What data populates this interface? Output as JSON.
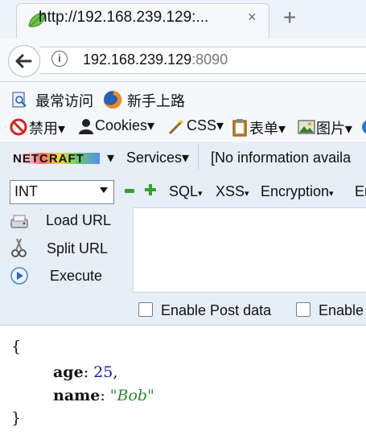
{
  "tab": {
    "title": "http://192.168.239.129:...",
    "close": "×",
    "new_tab": "+"
  },
  "nav": {
    "url_host": "192.168.239.129",
    "url_port": ":8090"
  },
  "bookmarks": [
    {
      "label": "最常访问",
      "icon": "bookmark-page-icon"
    },
    {
      "label": "新手上路",
      "icon": "firefox-icon"
    }
  ],
  "devbar": {
    "disable": "禁用",
    "cookies": "Cookies",
    "css": "CSS",
    "forms": "表单",
    "images": "图片"
  },
  "netcraft": {
    "logo": "NETCRAFT",
    "services": "Services",
    "info": "[No information availa"
  },
  "hackbar": {
    "select_value": "INT",
    "menus": {
      "sql": "SQL",
      "xss": "XSS",
      "encryption": "Encryption",
      "cut": "En"
    },
    "load_url": "Load URL",
    "split_url": "Split URL",
    "execute": "Execute",
    "post_data": "Enable Post data",
    "referrer": "Enable"
  },
  "content": {
    "open_brace": "{",
    "close_brace": "}",
    "fields": [
      {
        "key": "age",
        "value": "25",
        "suffix": ","
      },
      {
        "key": "name",
        "value": "\"Bob\"",
        "suffix": ""
      }
    ]
  }
}
